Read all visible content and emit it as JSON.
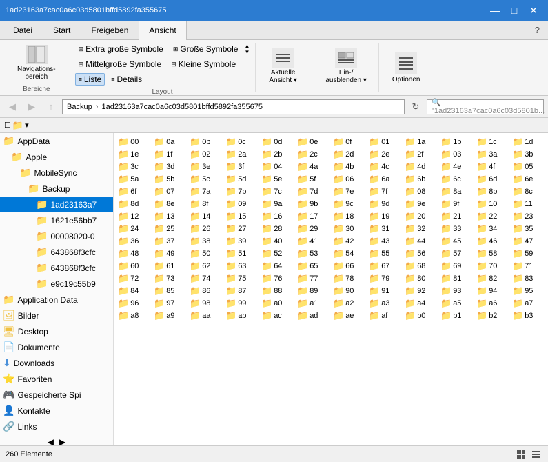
{
  "titlebar": {
    "title": "1ad23163a7cac0a6c03d5801bffd5892fa355675",
    "minimize": "—",
    "maximize": "□",
    "close": "✕"
  },
  "ribbon": {
    "tabs": [
      "Datei",
      "Start",
      "Freigeben",
      "Ansicht"
    ],
    "active_tab": "Ansicht",
    "groups": {
      "bereiche": {
        "label": "Bereiche",
        "items": [
          "Navigationsbereich"
        ]
      },
      "layout": {
        "label": "Layout",
        "items": [
          "Extra große Symbole",
          "Große Symbole",
          "Mittelgroße Symbole",
          "Kleine Symbole",
          "Liste",
          "Details"
        ]
      },
      "current_view": {
        "label": "Aktuelle Ansicht",
        "btn": "Aktuelle\nAnsicht ▾"
      },
      "show_hide": {
        "label": "",
        "btn": "Ein-/\nausblenden ▾"
      },
      "options": {
        "label": "",
        "btn": "Optionen"
      }
    }
  },
  "addressbar": {
    "back_label": "◀",
    "forward_label": "▶",
    "up_label": "↑",
    "path": "Backup > 1ad23163a7cac0a6c03d5801bffd5892fa355675",
    "search_placeholder": "\"1ad23163a7cac0a6c03d5801b..."
  },
  "quickaccess": {
    "checkbox_label": "☐",
    "folder_label": "📁",
    "down_label": "▾"
  },
  "sidebar": {
    "items": [
      {
        "label": "AppData",
        "indent": 0,
        "icon": "folder"
      },
      {
        "label": "Apple",
        "indent": 1,
        "icon": "folder"
      },
      {
        "label": "MobileSync",
        "indent": 2,
        "icon": "folder"
      },
      {
        "label": "Backup",
        "indent": 3,
        "icon": "folder"
      },
      {
        "label": "1ad23163a7",
        "indent": 4,
        "icon": "folder",
        "selected": true
      },
      {
        "label": "1621e56bb7",
        "indent": 4,
        "icon": "folder"
      },
      {
        "label": "00008020-0",
        "indent": 4,
        "icon": "folder"
      },
      {
        "label": "643868f3cfc",
        "indent": 4,
        "icon": "folder"
      },
      {
        "label": "643868f3cfc",
        "indent": 4,
        "icon": "folder"
      },
      {
        "label": "e9c19c55b9",
        "indent": 4,
        "icon": "folder"
      },
      {
        "label": "Application Data",
        "indent": 0,
        "icon": "folder"
      },
      {
        "label": "Bilder",
        "indent": 0,
        "icon": "folder-special"
      },
      {
        "label": "Desktop",
        "indent": 0,
        "icon": "folder-special"
      },
      {
        "label": "Dokumente",
        "indent": 0,
        "icon": "folder-special"
      },
      {
        "label": "Downloads",
        "indent": 0,
        "icon": "folder-down"
      },
      {
        "label": "Favoriten",
        "indent": 0,
        "icon": "folder-special"
      },
      {
        "label": "Gespeicherte Spi",
        "indent": 0,
        "icon": "folder-special"
      },
      {
        "label": "Kontakte",
        "indent": 0,
        "icon": "folder-special"
      },
      {
        "label": "Links",
        "indent": 0,
        "icon": "folder-special"
      }
    ]
  },
  "files": {
    "columns": [
      [
        "00",
        "0a",
        "0b",
        "0c",
        "0d",
        "0e",
        "0f",
        "01",
        "1a",
        "1b",
        "1c",
        "1d",
        "1e",
        "1f",
        "02",
        "2a",
        "2b",
        "2c",
        "2d",
        "2e"
      ],
      [
        "2f",
        "03",
        "3a",
        "3b",
        "3c",
        "3d",
        "3e",
        "3f",
        "04",
        "4a",
        "4b",
        "4c",
        "4d",
        "4e",
        "4f",
        "05",
        "5a",
        "5b",
        "5c",
        "5d"
      ],
      [
        "5e",
        "5f",
        "06",
        "6a",
        "6b",
        "6c",
        "6d",
        "6e",
        "6f",
        "07",
        "7a",
        "7b",
        "7c",
        "7d",
        "7e",
        "7f",
        "08",
        "8a",
        "8b",
        "8c"
      ],
      [
        "8d",
        "8e",
        "8f",
        "09",
        "9a",
        "9b",
        "9c",
        "9d",
        "9e",
        "9f",
        "10",
        "11",
        "12",
        "13",
        "14",
        "15",
        "16",
        "17",
        "18",
        "19"
      ],
      [
        "20",
        "21",
        "22",
        "23",
        "24",
        "25",
        "26",
        "27",
        "28",
        "29",
        "30",
        "31",
        "32",
        "33",
        "34",
        "35",
        "36",
        "37",
        "38",
        "39"
      ],
      [
        "40",
        "41",
        "42",
        "43",
        "44",
        "45",
        "46",
        "47",
        "48",
        "49",
        "50",
        "51",
        "52",
        "53",
        "54",
        "55",
        "56",
        "57",
        "58",
        "59"
      ],
      [
        "60",
        "61",
        "62",
        "63",
        "64",
        "65",
        "66",
        "67",
        "68",
        "69",
        "70",
        "71",
        "72",
        "73",
        "74",
        "75",
        "76",
        "77",
        "78",
        "79"
      ],
      [
        "80",
        "81",
        "82",
        "83",
        "84",
        "85",
        "86",
        "87",
        "88",
        "89",
        "90",
        "91",
        "92",
        "93",
        "94",
        "95",
        "96",
        "97",
        "98",
        "99"
      ],
      [
        "a0",
        "a1",
        "a2",
        "a3",
        "a4",
        "a5",
        "a6",
        "a7",
        "a8",
        "a9",
        "aa",
        "ab",
        "ac",
        "ad",
        "ae",
        "af",
        "b0",
        "b1",
        "b2",
        "b3"
      ]
    ]
  },
  "statusbar": {
    "count": "260 Elemente"
  }
}
